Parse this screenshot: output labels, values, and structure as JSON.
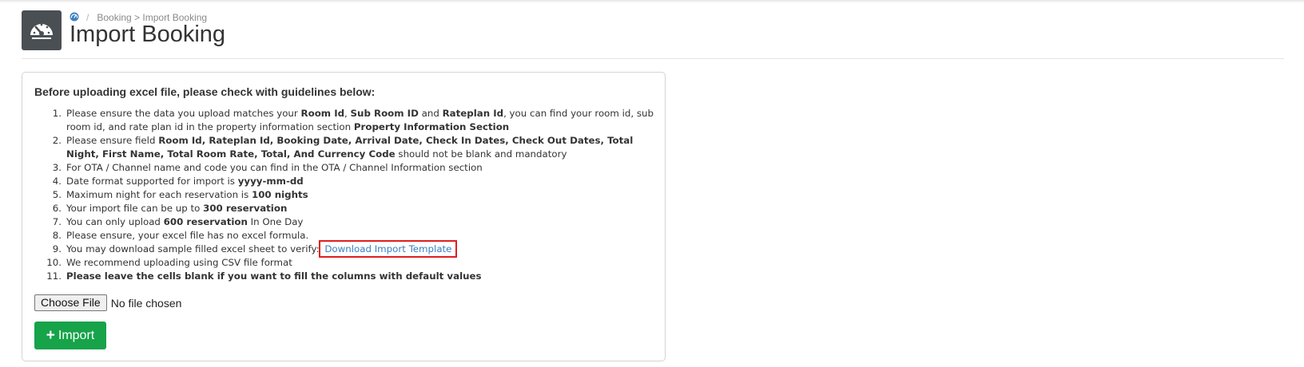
{
  "breadcrumb": {
    "home_icon": "dashboard-icon",
    "separator": "/",
    "path": "Booking > Import Booking"
  },
  "header": {
    "logo_icon": "speedometer-icon",
    "title": "Import Booking"
  },
  "panel": {
    "heading": "Before uploading excel file, please check with guidelines below:",
    "guidelines": [
      {
        "num": "1.",
        "parts": [
          {
            "t": "Please ensure the data you upload matches your "
          },
          {
            "t": "Room Id",
            "b": true
          },
          {
            "t": ", "
          },
          {
            "t": "Sub Room ID",
            "b": true
          },
          {
            "t": " and "
          },
          {
            "t": "Rateplan Id",
            "b": true
          },
          {
            "t": ", you can find your room id, sub room id, and rate plan id in the property information section "
          },
          {
            "t": "Property Information Section",
            "b": true
          }
        ]
      },
      {
        "num": "2.",
        "parts": [
          {
            "t": "Please ensure field "
          },
          {
            "t": "Room Id, Rateplan Id, Booking Date, Arrival Date, Check In Dates, Check Out Dates, Total Night, First Name, Total Room Rate, Total, And Currency Code",
            "b": true
          },
          {
            "t": " should not be blank and mandatory"
          }
        ]
      },
      {
        "num": "3.",
        "parts": [
          {
            "t": "For OTA / Channel name and code you can find in the OTA / Channel Information section"
          }
        ]
      },
      {
        "num": "4.",
        "parts": [
          {
            "t": "Date format supported for import is "
          },
          {
            "t": "yyyy-mm-dd",
            "b": true
          }
        ]
      },
      {
        "num": "5.",
        "parts": [
          {
            "t": "Maximum night for each reservation is "
          },
          {
            "t": "100 nights",
            "b": true
          }
        ]
      },
      {
        "num": "6.",
        "parts": [
          {
            "t": "Your import file can be up to "
          },
          {
            "t": "300 reservation",
            "b": true
          }
        ]
      },
      {
        "num": "7.",
        "parts": [
          {
            "t": "You can only upload "
          },
          {
            "t": "600 reservation",
            "b": true
          },
          {
            "t": " In One Day"
          }
        ]
      },
      {
        "num": "8.",
        "parts": [
          {
            "t": "Please ensure, your excel file has no excel formula."
          }
        ]
      },
      {
        "num": "9.",
        "parts": [
          {
            "t": "You may download sample filled excel sheet to verify: "
          },
          {
            "t": "Download Import Template",
            "link": true
          }
        ]
      },
      {
        "num": "10.",
        "parts": [
          {
            "t": "We recommend uploading using CSV file format"
          }
        ]
      },
      {
        "num": "11.",
        "parts": [
          {
            "t": "Please leave the cells blank if you want to fill the columns with default values",
            "b": true
          }
        ]
      }
    ],
    "file_input": {
      "button_label": "Choose File",
      "status": "No file chosen"
    },
    "import_button": {
      "icon": "plus-icon",
      "icon_glyph": "+",
      "label": "Import",
      "color": "#16a34a"
    }
  },
  "colors": {
    "link": "#3a7fc1",
    "highlight_box": "#e01e1e",
    "logo_bg": "#4a4f54"
  }
}
